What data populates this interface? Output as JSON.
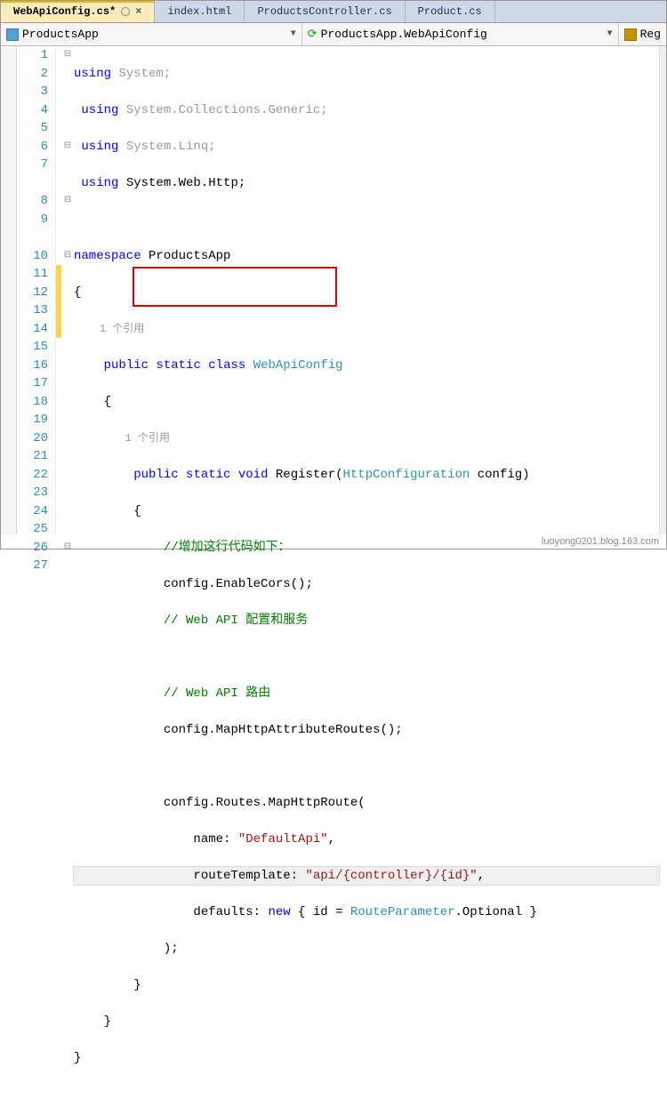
{
  "tabs": [
    {
      "label": "WebApiConfig.cs*",
      "active": true
    },
    {
      "label": "index.html",
      "active": false
    },
    {
      "label": "ProductsController.cs",
      "active": false
    },
    {
      "label": "Product.cs",
      "active": false
    }
  ],
  "nav": {
    "left": "ProductsApp",
    "right": "ProductsApp.WebApiConfig",
    "reg": "Reg"
  },
  "line_numbers": [
    "1",
    "2",
    "3",
    "4",
    "5",
    "6",
    "7",
    "",
    "8",
    "9",
    "",
    "10",
    "11",
    "12",
    "13",
    "14",
    "15",
    "16",
    "17",
    "18",
    "19",
    "20",
    "21",
    "22",
    "23",
    "24",
    "25",
    "26",
    "27"
  ],
  "outline": [
    "⊟",
    "",
    "",
    "",
    "",
    "⊟",
    "",
    "",
    "⊟",
    "",
    "",
    "⊟",
    "",
    "",
    "",
    "",
    "",
    "",
    "",
    "",
    "",
    "",
    "",
    "",
    "",
    "",
    "",
    "⊟",
    ""
  ],
  "mod": [
    "",
    "",
    "",
    "",
    "",
    "",
    "",
    "",
    "",
    "",
    "",
    "",
    "y",
    "y",
    "y",
    "y",
    "",
    "",
    "",
    "",
    "",
    "",
    "",
    "",
    "",
    "",
    "",
    "",
    ""
  ],
  "code": {
    "l1": {
      "a": "using",
      "b": " System;"
    },
    "l2": {
      "a": "using",
      "b": " System.Collections.Generic;"
    },
    "l3": {
      "a": "using",
      "b": " System.Linq;"
    },
    "l4": {
      "a": "using",
      "b": " System.Web.Http;"
    },
    "l6": {
      "a": "namespace",
      "b": " ProductsApp"
    },
    "ref": "1 个引用",
    "l8": {
      "a": "public",
      "b": "static",
      "c": "class",
      "d": "WebApiConfig"
    },
    "l10": {
      "a": "public",
      "b": "static",
      "c": "void",
      "d": " Register(",
      "e": "HttpConfiguration",
      "f": " config)"
    },
    "l12": "//增加这行代码如下：",
    "l13": "config.EnableCors();",
    "l14": "// Web API 配置和服务",
    "l16": "// Web API 路由",
    "l17": "config.MapHttpAttributeRoutes();",
    "l19": "config.Routes.MapHttpRoute(",
    "l20a": "name: ",
    "l20b": "\"DefaultApi\"",
    "l20c": ",",
    "l21a": "routeTemplate: ",
    "l21b": "\"api/{controller}/{id}\"",
    "l21c": ",",
    "l22a": "defaults: ",
    "l22b": "new",
    "l22c": " { id = ",
    "l22d": "RouteParameter",
    "l22e": ".Optional }",
    "l23": ");",
    "brace_open": "{",
    "brace_close": "}"
  },
  "watermark": "luoyong0201.blog.163.com"
}
